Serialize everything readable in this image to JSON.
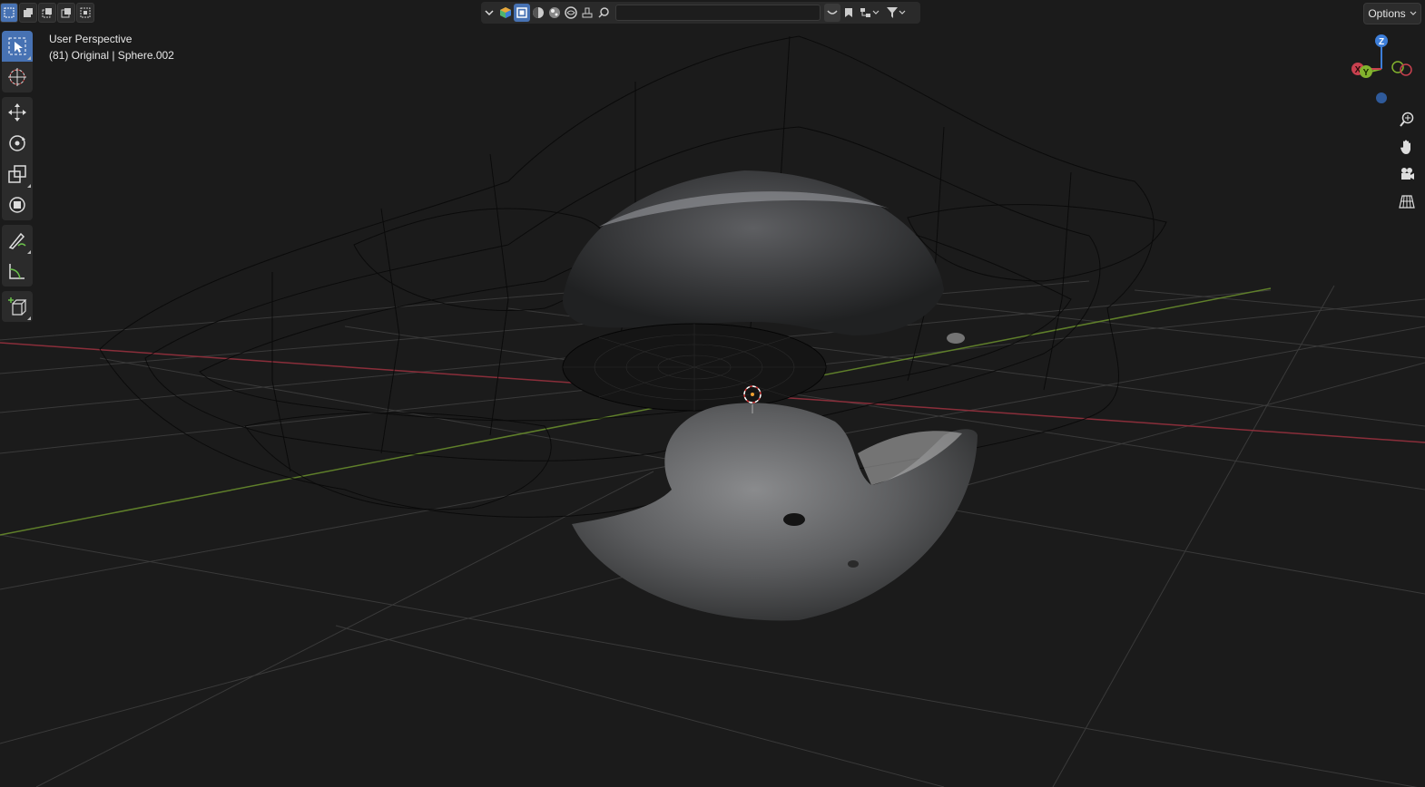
{
  "viewport": {
    "perspective_label": "User Perspective",
    "object_info": "(81) Original | Sphere.002"
  },
  "header": {
    "search_placeholder": "",
    "options_label": "Options"
  },
  "toolbar": {
    "tools": [
      "select-box",
      "cursor",
      "move",
      "rotate",
      "scale",
      "transform",
      "annotate",
      "measure",
      "add-cube"
    ],
    "active_tool": "select-box"
  },
  "gizmo": {
    "z_label": "Z",
    "y_label": "Y",
    "x_label": "X"
  },
  "colors": {
    "accent": "#4772b3",
    "x_axis": "#c8404f",
    "y_axis": "#83b32e",
    "z_axis": "#3d7ed9"
  }
}
